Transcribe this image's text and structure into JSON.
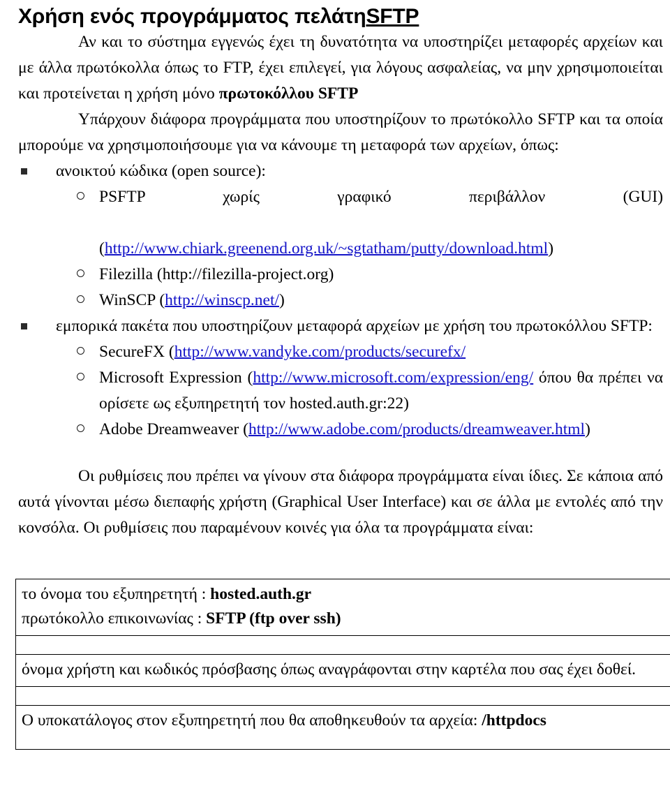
{
  "document": {
    "title_main": "Χρήση ενός προγράμματος πελάτη",
    "title_tail": "SFTP",
    "intro_paragraph_1": "Αν και το σύστημα εγγενώς έχει τη δυνατότητα να υποστηρίζει μεταφορές αρχείων και με άλλα πρωτόκολλα όπως το FTP, έχει επιλεγεί, για λόγους ασφαλείας, να μην χρησιμοποιείται και προτείνεται η χρήση μόνο ",
    "intro_paragraph_1_bold": "πρωτοκόλλου SFTP",
    "intro_paragraph_2": "Υπάρχουν διάφορα προγράμματα που υποστηρίζουν το πρωτόκολλο SFTP και τα οποία μπορούμε να χρησιμοποιήσουμε για να κάνουμε τη μεταφορά των αρχείων, όπως:",
    "bullet_open_source": "ανοικτού κώδικα (open source):",
    "psftp_name": "PSFTP",
    "psftp_word_2": "χωρίς",
    "psftp_word_3": "γραφικό",
    "psftp_word_4": "περιβάλλον",
    "psftp_word_5": "(GUI)",
    "psftp_url": "http://www.chiark.greenend.org.uk/~sgtatham/putty/download.html",
    "filezilla_label": "Filezilla (http://filezilla-project.org)",
    "winscp_label": "WinSCP (",
    "winscp_url": "http://winscp.net/",
    "winscp_close": ")",
    "bullet_commercial": "εμπορικά πακέτα που υποστηρίζουν μεταφορά αρχείων με χρήση του πρωτοκόλλου SFTP:",
    "securefx_label": "SecureFX (",
    "securefx_url": "http://www.vandyke.com/products/securefx/",
    "msexpression_label": "Microsoft Expression (",
    "msexpression_url": "http://www.microsoft.com/expression/eng/",
    "msexpression_tail": " όπου θα πρέπει να ορίσετε ως εξυπηρετητή τον hosted.auth.gr:22)",
    "dreamweaver_label": "Adobe Dreamweaver (",
    "dreamweaver_url": "http://www.adobe.com/products/dreamweaver.html",
    "dreamweaver_close": ")",
    "settings_paragraph": "Οι ρυθμίσεις που πρέπει να γίνουν στα διάφορα προγράμματα είναι ίδιες. Σε κάποια από αυτά γίνονται  μέσω διεπαφής χρήστη (Graphical User Interface) και σε άλλα με εντολές από την κονσόλα. Οι ρυθμίσεις που παραμένουν κοινές για όλα τα προγράμματα είναι:"
  },
  "info_table": {
    "rows": [
      {
        "line_1_label": "το όνομα του εξυπηρετητή : ",
        "line_1_value": "hosted.auth.gr",
        "line_2_label": "πρωτόκολλο επικοινωνίας : ",
        "line_2_value": "SFTP (ftp over ssh)"
      },
      {
        "credentials_text": "όνομα χρήστη και κωδικός πρόσβασης όπως αναγράφονται στην καρτέλα που σας έχει δοθεί."
      },
      {
        "subdir_label": "Ο υποκατάλογος στον εξυπηρετητή που θα αποθηκευθούν τα αρχεία:  ",
        "subdir_value": "/httpdocs"
      }
    ]
  },
  "colors": {
    "link": "#1414c8",
    "text": "#000000",
    "border": "#000000",
    "background": "#ffffff"
  }
}
